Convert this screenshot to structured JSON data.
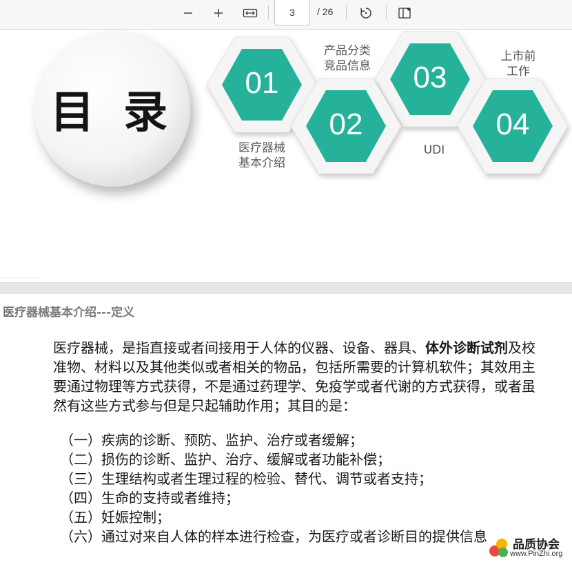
{
  "toolbar": {
    "page_current": "3",
    "page_total": "/ 26"
  },
  "slide1": {
    "title": "目 录",
    "items": [
      {
        "num": "01",
        "label": "医疗器械\n基本介绍"
      },
      {
        "num": "02",
        "label": "产品分类\n竞品信息"
      },
      {
        "num": "03",
        "label": "UDI"
      },
      {
        "num": "04",
        "label": "上市前\n工作"
      }
    ],
    "colors": {
      "hex_fill": "#26b29a",
      "hex_frame": "#f2f2f2"
    }
  },
  "slide2": {
    "title": "医疗器械基本介绍---定义",
    "para_part1": "医疗器械，是指直接或者间接用于人体的仪器、设备、器具、",
    "para_bold": "体外诊断试剂",
    "para_part2": "及校准物、材料以及其他类似或者相关的物品，包括所需要的计算机软件；其效用主要通过物理等方式获得，不是通过药理学、免疫学或者代谢的方式获得，或者虽然有这些方式参与但是只起辅助作用；其目的是：",
    "list": [
      "（一）疾病的诊断、预防、监护、治疗或者缓解；",
      "（二）损伤的诊断、监护、治疗、缓解或者功能补偿；",
      "（三）生理结构或者生理过程的检验、替代、调节或者支持；",
      "（四）生命的支持或者维持；",
      "（五）妊娠控制；",
      "（六）通过对来自人体的样本进行检查，为医疗或者诊断目的提供信息"
    ]
  },
  "watermark": {
    "name": "品质协会",
    "url": "www.PinZhi.org"
  }
}
